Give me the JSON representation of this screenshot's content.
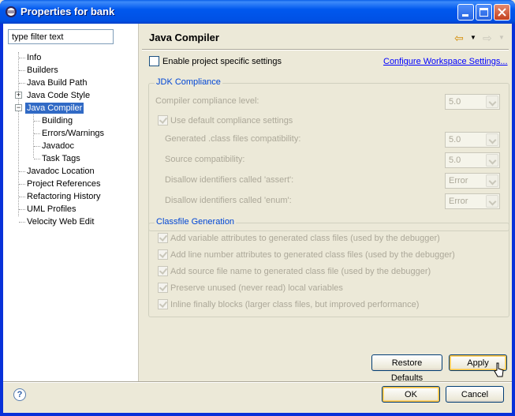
{
  "window": {
    "title": "Properties for bank"
  },
  "filter": {
    "placeholder": "type filter text"
  },
  "tree": {
    "items": [
      {
        "label": "Info"
      },
      {
        "label": "Builders"
      },
      {
        "label": "Java Build Path"
      },
      {
        "label": "Java Code Style"
      },
      {
        "label": "Java Compiler"
      },
      {
        "label": "Building"
      },
      {
        "label": "Errors/Warnings"
      },
      {
        "label": "Javadoc"
      },
      {
        "label": "Task Tags"
      },
      {
        "label": "Javadoc Location"
      },
      {
        "label": "Project References"
      },
      {
        "label": "Refactoring History"
      },
      {
        "label": "UML Profiles"
      },
      {
        "label": "Velocity Web Edit"
      }
    ]
  },
  "page": {
    "title": "Java Compiler",
    "enable_specific": "Enable project specific settings",
    "configure_link": "Configure Workspace Settings..."
  },
  "jdk": {
    "group_title": "JDK Compliance",
    "compliance_label": "Compiler compliance level:",
    "compliance_value": "5.0",
    "use_default": "Use default compliance settings",
    "generated_label": "Generated .class files compatibility:",
    "generated_value": "5.0",
    "source_label": "Source compatibility:",
    "source_value": "5.0",
    "assert_label": "Disallow identifiers called 'assert':",
    "assert_value": "Error",
    "enum_label": "Disallow identifiers called 'enum':",
    "enum_value": "Error"
  },
  "classfile": {
    "group_title": "Classfile Generation",
    "options": [
      "Add variable attributes to generated class files (used by the debugger)",
      "Add line number attributes to generated class files (used by the debugger)",
      "Add source file name to generated class file (used by the debugger)",
      "Preserve unused (never read) local variables",
      "Inline finally blocks (larger class files, but improved performance)"
    ]
  },
  "buttons": {
    "restore": "Restore Defaults",
    "apply": "Apply",
    "ok": "OK",
    "cancel": "Cancel"
  },
  "icons": {
    "app": "eclipse-icon",
    "help": "help-icon",
    "back": "back-arrow-icon",
    "forward": "forward-arrow-icon"
  }
}
